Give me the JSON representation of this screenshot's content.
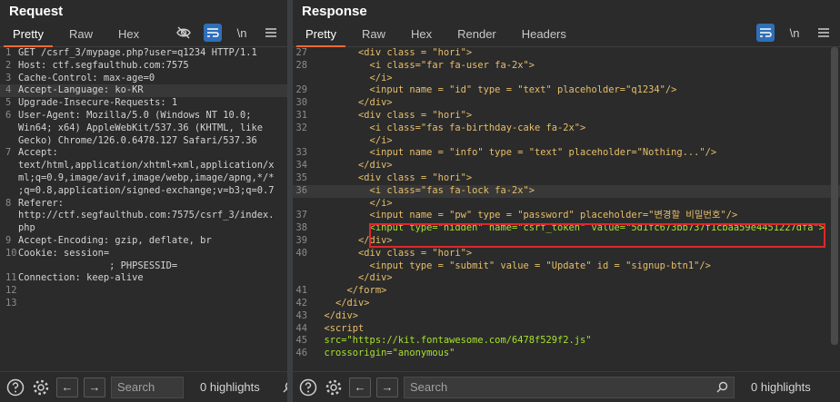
{
  "request": {
    "title": "Request",
    "tabs": [
      "Pretty",
      "Raw",
      "Hex"
    ],
    "tools": {
      "newline": "\\n"
    },
    "lines": [
      {
        "n": "1",
        "t": "GET /csrf_3/mypage.php?user=q1234 HTTP/1.1"
      },
      {
        "n": "2",
        "t": "Host: ctf.segfaulthub.com:7575"
      },
      {
        "n": "3",
        "t": "Cache-Control: max-age=0"
      },
      {
        "n": "4",
        "t": "Accept-Language: ko-KR"
      },
      {
        "n": "5",
        "t": "Upgrade-Insecure-Requests: 1"
      },
      {
        "n": "6",
        "t": "User-Agent: Mozilla/5.0 (Windows NT 10.0;"
      },
      {
        "n": "",
        "t": "Win64; x64) AppleWebKit/537.36 (KHTML, like"
      },
      {
        "n": "",
        "t": "Gecko) Chrome/126.0.6478.127 Safari/537.36"
      },
      {
        "n": "7",
        "t": "Accept:"
      },
      {
        "n": "",
        "t": "text/html,application/xhtml+xml,application/x"
      },
      {
        "n": "",
        "t": "ml;q=0.9,image/avif,image/webp,image/apng,*/*"
      },
      {
        "n": "",
        "t": ";q=0.8,application/signed-exchange;v=b3;q=0.7"
      },
      {
        "n": "8",
        "t": "Referer:"
      },
      {
        "n": "",
        "t": "http://ctf.segfaulthub.com:7575/csrf_3/index."
      },
      {
        "n": "",
        "t": "php"
      },
      {
        "n": "9",
        "t": "Accept-Encoding: gzip, deflate, br"
      },
      {
        "n": "10",
        "t": "Cookie: session="
      },
      {
        "n": "",
        "t": ""
      },
      {
        "n": "",
        "t": "                ; PHPSESSID="
      },
      {
        "n": "",
        "t": ""
      },
      {
        "n": "11",
        "t": "Connection: keep-alive"
      },
      {
        "n": "12",
        "t": ""
      },
      {
        "n": "13",
        "t": ""
      }
    ],
    "footer": {
      "search_placeholder": "Search",
      "highlights": "0 highlights"
    }
  },
  "response": {
    "title": "Response",
    "tabs": [
      "Pretty",
      "Raw",
      "Hex",
      "Render",
      "Headers"
    ],
    "tools": {
      "newline": "\\n"
    },
    "lines": [
      {
        "n": "27",
        "t": "        <div class = \"hori\">"
      },
      {
        "n": "28",
        "t": "          <i class=\"far fa-user fa-2x\">"
      },
      {
        "n": "",
        "t": "          </i>"
      },
      {
        "n": "29",
        "t": "          <input name = \"id\" type = \"text\" placeholder=\"q1234\"/>"
      },
      {
        "n": "30",
        "t": "        </div>"
      },
      {
        "n": "31",
        "t": "        <div class = \"hori\">"
      },
      {
        "n": "32",
        "t": "          <i class=\"fas fa-birthday-cake fa-2x\">"
      },
      {
        "n": "",
        "t": "          </i>"
      },
      {
        "n": "33",
        "t": "          <input name = \"info\" type = \"text\" placeholder=\"Nothing...\"/>"
      },
      {
        "n": "34",
        "t": "        </div>"
      },
      {
        "n": "35",
        "t": "        <div class = \"hori\">"
      },
      {
        "n": "36",
        "t": "          <i class=\"fas fa-lock fa-2x\">"
      },
      {
        "n": "",
        "t": "          </i>"
      },
      {
        "n": "37",
        "t": "          <input name = \"pw\" type = \"password\" placeholder=\"변경할 비밀번호\"/>"
      },
      {
        "n": "38",
        "t": "          <input type=\"hidden\" name=\"csrf_token\" value=\"5d1fc673bb737f1cbaa59e4451227dfa\">"
      },
      {
        "n": "39",
        "t": "        </div>"
      },
      {
        "n": "40",
        "t": "        <div class = \"hori\">"
      },
      {
        "n": "",
        "t": "          <input type = \"submit\" value = \"Update\" id = \"signup-btn1\"/>"
      },
      {
        "n": "",
        "t": "        </div>"
      },
      {
        "n": "41",
        "t": "      </form>"
      },
      {
        "n": "42",
        "t": "    </div>"
      },
      {
        "n": "43",
        "t": "  </div>"
      },
      {
        "n": "44",
        "t": "  <script"
      },
      {
        "n": "45",
        "t": "  src=\"https://kit.fontawesome.com/6478f529f2.js\""
      },
      {
        "n": "46",
        "t": "  crossorigin=\"anonymous\""
      }
    ],
    "footer": {
      "search_placeholder": "Search",
      "highlights": "0 highlights"
    }
  },
  "colors": {
    "accent": "#ff6633",
    "highlight_box": "#e0262b",
    "button_blue": "#2f6fb8"
  },
  "icons": [
    "eye-off-icon",
    "wrap-icon",
    "newline-icon",
    "menu-icon",
    "help-icon",
    "settings-icon",
    "arrow-left-icon",
    "arrow-right-icon",
    "search-icon"
  ]
}
